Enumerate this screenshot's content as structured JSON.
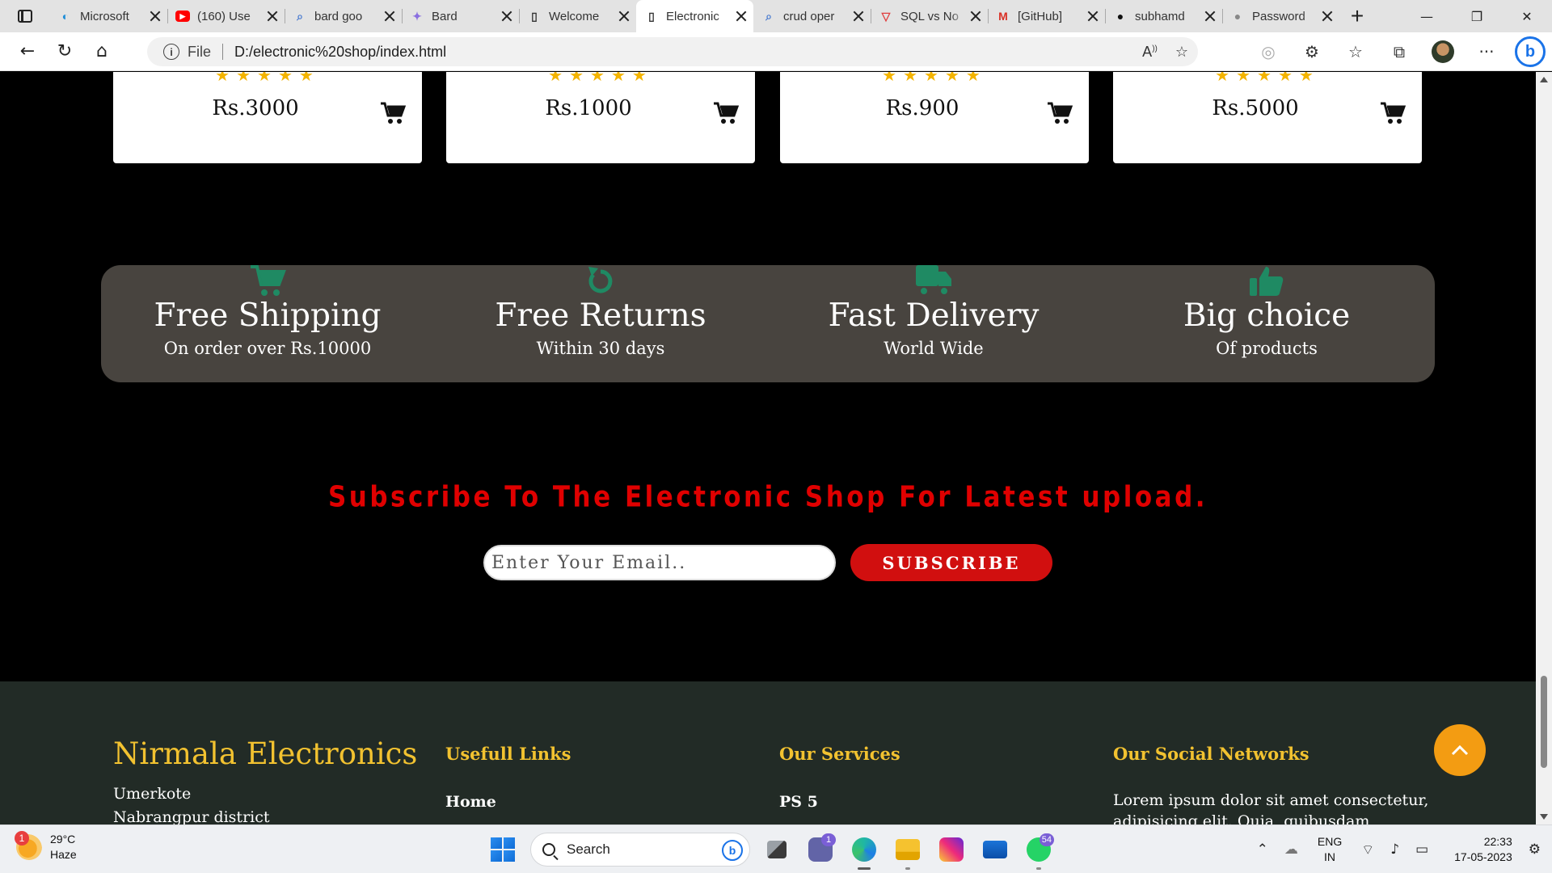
{
  "browser": {
    "tabs": [
      {
        "title": "Microsoft",
        "icon": "edge-icon",
        "color": "#1e8ed8"
      },
      {
        "title": "(160) Use",
        "icon": "youtube-icon",
        "color": "#ff0000"
      },
      {
        "title": "bard goo",
        "icon": "search-icon",
        "color": "#4a7bd0"
      },
      {
        "title": "Bard",
        "icon": "bard-sparkle-icon",
        "color": "#8a6fe0"
      },
      {
        "title": "Welcome",
        "icon": "document-icon",
        "color": "#333333"
      },
      {
        "title": "Electronic",
        "icon": "document-icon",
        "color": "#333333",
        "active": true
      },
      {
        "title": "crud oper",
        "icon": "search-icon",
        "color": "#4a7bd0"
      },
      {
        "title": "SQL vs No",
        "icon": "triangle-icon",
        "color": "#e04040"
      },
      {
        "title": "[GitHub]",
        "icon": "gmail-icon",
        "color": "#d93025"
      },
      {
        "title": "subhamd",
        "icon": "github-icon",
        "color": "#111111"
      },
      {
        "title": "Password",
        "icon": "github-icon",
        "color": "#888888"
      }
    ],
    "address": {
      "scheme_label": "File",
      "url": "D:/electronic%20shop/index.html"
    }
  },
  "page": {
    "products": [
      {
        "price": "Rs.3000",
        "stars": "★★★★★"
      },
      {
        "price": "Rs.1000",
        "stars": "★★★★★"
      },
      {
        "price": "Rs.900",
        "stars": "★★★★★"
      },
      {
        "price": "Rs.5000",
        "stars": "★★★★★"
      }
    ],
    "features": [
      {
        "title": "Free Shipping",
        "subtitle": "On order over Rs.10000",
        "icon": "cart-icon"
      },
      {
        "title": "Free Returns",
        "subtitle": "Within 30 days",
        "icon": "return-icon"
      },
      {
        "title": "Fast Delivery",
        "subtitle": "World Wide",
        "icon": "truck-icon"
      },
      {
        "title": "Big choice",
        "subtitle": "Of products",
        "icon": "thumbs-up-icon"
      }
    ],
    "subscribe": {
      "title": "Subscribe To The Electronic Shop For Latest upload.",
      "placeholder": "Enter Your Email..",
      "button": "SUBSCRIBE"
    },
    "footer": {
      "brand": "Nirmala Electronics",
      "address_line1": "Umerkote",
      "address_line2": "Nabrangpur district",
      "links_heading": "Usefull Links",
      "first_link": "Home",
      "services_heading": "Our Services",
      "first_service": "PS 5",
      "social_heading": "Our Social Networks",
      "social_text": "Lorem ipsum dolor sit amet consectetur, adipisicing elit. Quia, quibusdam"
    },
    "colors": {
      "accent_green": "#1f8a63",
      "footer_yellow": "#f2c230",
      "subscribe_red": "#e00000",
      "button_red": "#d10f0f",
      "scrolltop_orange": "#f39c12"
    }
  },
  "taskbar": {
    "weather": {
      "temp": "29°C",
      "condition": "Haze",
      "badge": "1"
    },
    "search_label": "Search",
    "badges": {
      "teams": "1",
      "whatsapp": "54"
    },
    "lang_line1": "ENG",
    "lang_line2": "IN",
    "time": "22:33",
    "date": "17-05-2023"
  }
}
